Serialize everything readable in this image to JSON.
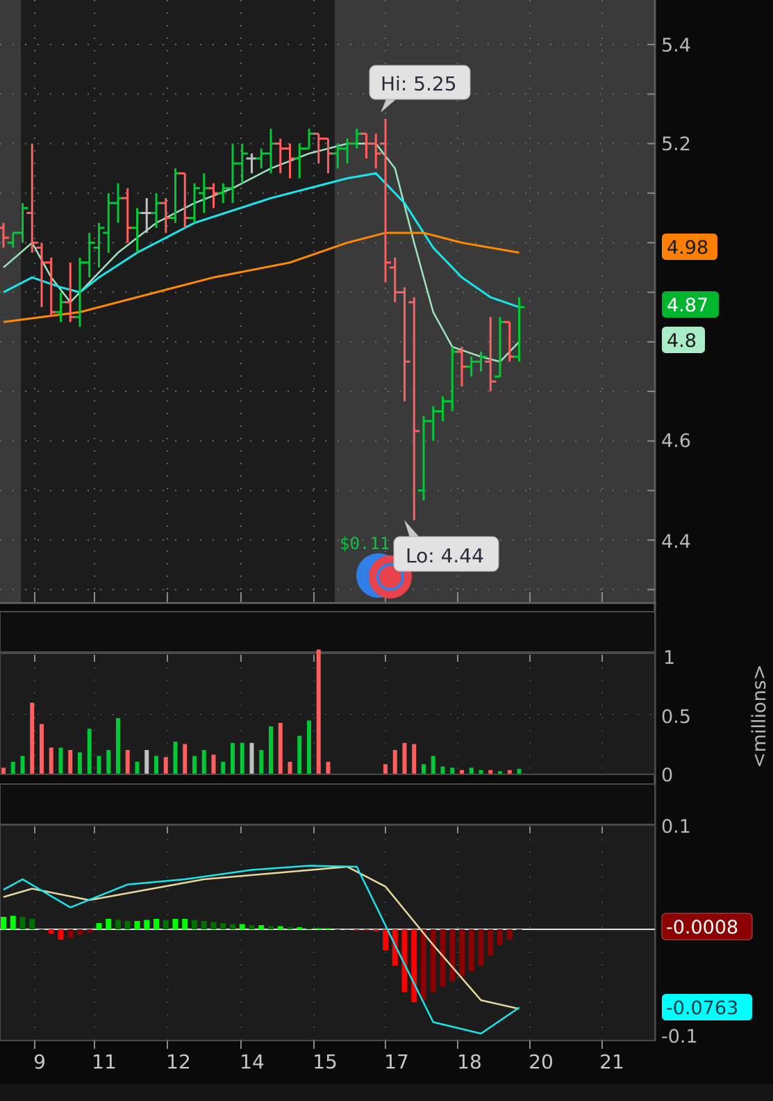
{
  "colors": {
    "up": "#00c837",
    "down": "#ff5f5f",
    "flat": "#c0c0c0",
    "ema_fast": "#9fe3c0",
    "ema_mid": "#19e6ea",
    "sma_slow": "#ff8a00",
    "macd_value": "#19e6ea",
    "macd_avg": "#e8d9a0",
    "hist_up_strong": "#00ff00",
    "hist_up_weak": "#006f00",
    "hist_down_strong": "#ff0000",
    "hist_down_weak": "#8b0000"
  },
  "chart_data": [
    {
      "type": "ohlc",
      "title": "Price",
      "x_ticks": [
        "9",
        "11",
        "12",
        "14",
        "15",
        "17",
        "18",
        "20",
        "21"
      ],
      "y_ticks": [
        "5.4",
        "5.2",
        "4.6",
        "4.4"
      ],
      "ylim": [
        4.3,
        5.49
      ],
      "bars": [
        [
          5.03,
          5.04,
          4.99,
          5.01
        ],
        [
          5.0,
          5.02,
          4.99,
          5.02
        ],
        [
          5.02,
          5.08,
          5.0,
          5.07
        ],
        [
          5.06,
          5.2,
          4.98,
          5.0
        ],
        [
          4.99,
          5.0,
          4.87,
          4.96
        ],
        [
          4.96,
          4.97,
          4.85,
          4.86
        ],
        [
          4.86,
          4.9,
          4.84,
          4.88
        ],
        [
          4.88,
          4.96,
          4.84,
          4.85
        ],
        [
          4.85,
          4.97,
          4.83,
          4.96
        ],
        [
          4.96,
          5.02,
          4.93,
          5.0
        ],
        [
          4.99,
          5.04,
          4.95,
          5.03
        ],
        [
          5.02,
          5.1,
          4.98,
          5.08
        ],
        [
          5.08,
          5.12,
          5.04,
          5.09
        ],
        [
          5.09,
          5.11,
          5.0,
          5.03
        ],
        [
          5.03,
          5.07,
          4.98,
          5.06
        ],
        [
          5.06,
          5.09,
          5.02,
          5.06
        ],
        [
          5.06,
          5.1,
          5.03,
          5.08
        ],
        [
          5.08,
          5.09,
          5.02,
          5.05
        ],
        [
          5.05,
          5.15,
          5.04,
          5.14
        ],
        [
          5.14,
          5.14,
          5.03,
          5.05
        ],
        [
          5.05,
          5.12,
          5.04,
          5.11
        ],
        [
          5.1,
          5.14,
          5.06,
          5.11
        ],
        [
          5.11,
          5.12,
          5.07,
          5.1
        ],
        [
          5.1,
          5.12,
          5.08,
          5.11
        ],
        [
          5.11,
          5.2,
          5.08,
          5.16
        ],
        [
          5.16,
          5.2,
          5.12,
          5.18
        ],
        [
          5.17,
          5.18,
          5.14,
          5.17
        ],
        [
          5.17,
          5.19,
          5.15,
          5.18
        ],
        [
          5.18,
          5.23,
          5.14,
          5.2
        ],
        [
          5.2,
          5.21,
          5.14,
          5.19
        ],
        [
          5.19,
          5.2,
          5.13,
          5.17
        ],
        [
          5.17,
          5.2,
          5.13,
          5.19
        ],
        [
          5.19,
          5.23,
          5.19,
          5.22
        ],
        [
          5.22,
          5.22,
          5.16,
          5.21
        ],
        [
          5.21,
          5.21,
          5.14,
          5.18
        ],
        [
          5.18,
          5.2,
          5.15,
          5.19
        ],
        [
          5.19,
          5.21,
          5.16,
          5.2
        ],
        [
          5.2,
          5.23,
          5.19,
          5.22
        ],
        [
          5.22,
          5.22,
          5.17,
          5.2
        ],
        [
          5.2,
          5.22,
          5.15,
          5.18
        ],
        [
          5.2,
          5.25,
          4.92,
          4.96
        ],
        [
          4.95,
          4.97,
          4.88,
          4.9
        ],
        [
          4.9,
          4.91,
          4.68,
          4.76
        ],
        [
          4.88,
          4.89,
          4.44,
          4.62
        ],
        [
          4.5,
          4.65,
          4.48,
          4.64
        ],
        [
          4.64,
          4.67,
          4.6,
          4.66
        ],
        [
          4.66,
          4.69,
          4.64,
          4.68
        ],
        [
          4.68,
          4.79,
          4.66,
          4.78
        ],
        [
          4.78,
          4.79,
          4.71,
          4.75
        ],
        [
          4.75,
          4.77,
          4.73,
          4.76
        ],
        [
          4.76,
          4.78,
          4.74,
          4.77
        ],
        [
          4.76,
          4.85,
          4.7,
          4.72
        ],
        [
          4.73,
          4.85,
          4.73,
          4.84
        ],
        [
          4.84,
          4.84,
          4.76,
          4.77
        ],
        [
          4.77,
          4.89,
          4.76,
          4.87
        ]
      ],
      "series": [
        {
          "name": "ema_fast",
          "points": [
            [
              0,
              4.95
            ],
            [
              3,
              5.0
            ],
            [
              5,
              4.93
            ],
            [
              7,
              4.88
            ],
            [
              9,
              4.92
            ],
            [
              12,
              4.98
            ],
            [
              16,
              5.04
            ],
            [
              20,
              5.08
            ],
            [
              24,
              5.11
            ],
            [
              28,
              5.15
            ],
            [
              32,
              5.18
            ],
            [
              36,
              5.2
            ],
            [
              39,
              5.2
            ],
            [
              41,
              5.15
            ],
            [
              43,
              5.0
            ],
            [
              45,
              4.86
            ],
            [
              47,
              4.79
            ],
            [
              50,
              4.77
            ],
            [
              52,
              4.76
            ],
            [
              54,
              4.8
            ]
          ]
        },
        {
          "name": "ema_mid",
          "points": [
            [
              0,
              4.9
            ],
            [
              3,
              4.93
            ],
            [
              6,
              4.91
            ],
            [
              8,
              4.9
            ],
            [
              10,
              4.93
            ],
            [
              14,
              4.98
            ],
            [
              20,
              5.04
            ],
            [
              28,
              5.09
            ],
            [
              36,
              5.13
            ],
            [
              39,
              5.14
            ],
            [
              42,
              5.08
            ],
            [
              45,
              4.99
            ],
            [
              48,
              4.93
            ],
            [
              51,
              4.89
            ],
            [
              54,
              4.87
            ]
          ]
        },
        {
          "name": "sma_slow",
          "points": [
            [
              0,
              4.84
            ],
            [
              8,
              4.86
            ],
            [
              14,
              4.89
            ],
            [
              22,
              4.93
            ],
            [
              30,
              4.96
            ],
            [
              36,
              5.0
            ],
            [
              40,
              5.02
            ],
            [
              44,
              5.02
            ],
            [
              48,
              5.0
            ],
            [
              54,
              4.98
            ]
          ]
        }
      ],
      "hi_label": "Hi: 5.25",
      "lo_label": "Lo: 4.44",
      "event_label": "$0.11",
      "price_bubbles": [
        {
          "value": "4.98",
          "price": 4.98,
          "bg": "#ff8000",
          "fg": "#1a1a1a"
        },
        {
          "value": "4.87",
          "price": 4.87,
          "bg": "#00b52e",
          "fg": "#ffffff"
        },
        {
          "value": "4.8",
          "price": 4.8,
          "bg": "#a8edc8",
          "fg": "#1a1a1a"
        }
      ]
    },
    {
      "type": "bar",
      "title": "Volume",
      "unit_label": "<millions>",
      "y_ticks": [
        "1",
        "0.5",
        "0"
      ],
      "ylim": [
        0,
        1
      ],
      "values": [
        0.05,
        0.1,
        0.15,
        0.6,
        0.42,
        0.22,
        0.22,
        0.2,
        0.18,
        0.38,
        0.15,
        0.2,
        0.47,
        0.2,
        0.1,
        0.2,
        0.15,
        0.14,
        0.27,
        0.25,
        0.15,
        0.2,
        0.16,
        0.1,
        0.26,
        0.26,
        0.26,
        0.2,
        0.4,
        0.43,
        0.1,
        0.32,
        0.45,
        1.05,
        0.1,
        0,
        0,
        0,
        0,
        0,
        0.08,
        0.2,
        0.26,
        0.25,
        0.08,
        0.15,
        0.06,
        0.05,
        0.03,
        0.05,
        0.03,
        0.03,
        0.02,
        0.03,
        0.04
      ]
    },
    {
      "type": "line",
      "title": "MACD",
      "y_ticks": [
        "0.1",
        "-0.1"
      ],
      "ylim": [
        -0.1,
        0.1
      ],
      "value_points": [
        [
          0,
          0.038
        ],
        [
          2,
          0.048
        ],
        [
          7,
          0.021
        ],
        [
          13,
          0.043
        ],
        [
          19,
          0.048
        ],
        [
          26,
          0.057
        ],
        [
          32,
          0.061
        ],
        [
          37,
          0.06
        ],
        [
          41,
          -0.015
        ],
        [
          45,
          -0.089
        ],
        [
          50,
          -0.1
        ],
        [
          54,
          -0.075
        ]
      ],
      "avg_points": [
        [
          0,
          0.031
        ],
        [
          3,
          0.039
        ],
        [
          9,
          0.028
        ],
        [
          21,
          0.048
        ],
        [
          36,
          0.06
        ],
        [
          40,
          0.041
        ],
        [
          45,
          -0.015
        ],
        [
          50,
          -0.068
        ],
        [
          54,
          -0.0763
        ]
      ],
      "histogram": [
        0.012,
        0.013,
        0.012,
        0.01,
        0.0,
        -0.004,
        -0.01,
        -0.008,
        -0.005,
        -0.003,
        0.006,
        0.01,
        0.009,
        0.008,
        0.008,
        0.009,
        0.01,
        0.009,
        0.01,
        0.01,
        0.009,
        0.008,
        0.007,
        0.006,
        0.005,
        0.005,
        0.004,
        0.004,
        0.003,
        0.003,
        0.002,
        0.002,
        0.001,
        0.001,
        0.001,
        0.0,
        0.0,
        -0.001,
        -0.001,
        -0.002,
        -0.02,
        -0.035,
        -0.06,
        -0.07,
        -0.068,
        -0.06,
        -0.055,
        -0.05,
        -0.045,
        -0.04,
        -0.035,
        -0.025,
        -0.015,
        -0.01,
        -0.0008
      ],
      "bubbles": [
        {
          "value": "-0.0008",
          "num": -0.0008,
          "bg": "#8b0000",
          "fg": "#ffffff"
        },
        {
          "value": "-0.0763",
          "num": -0.0763,
          "bg": "#00ffff",
          "fg": "#0a3a3a"
        }
      ]
    }
  ]
}
